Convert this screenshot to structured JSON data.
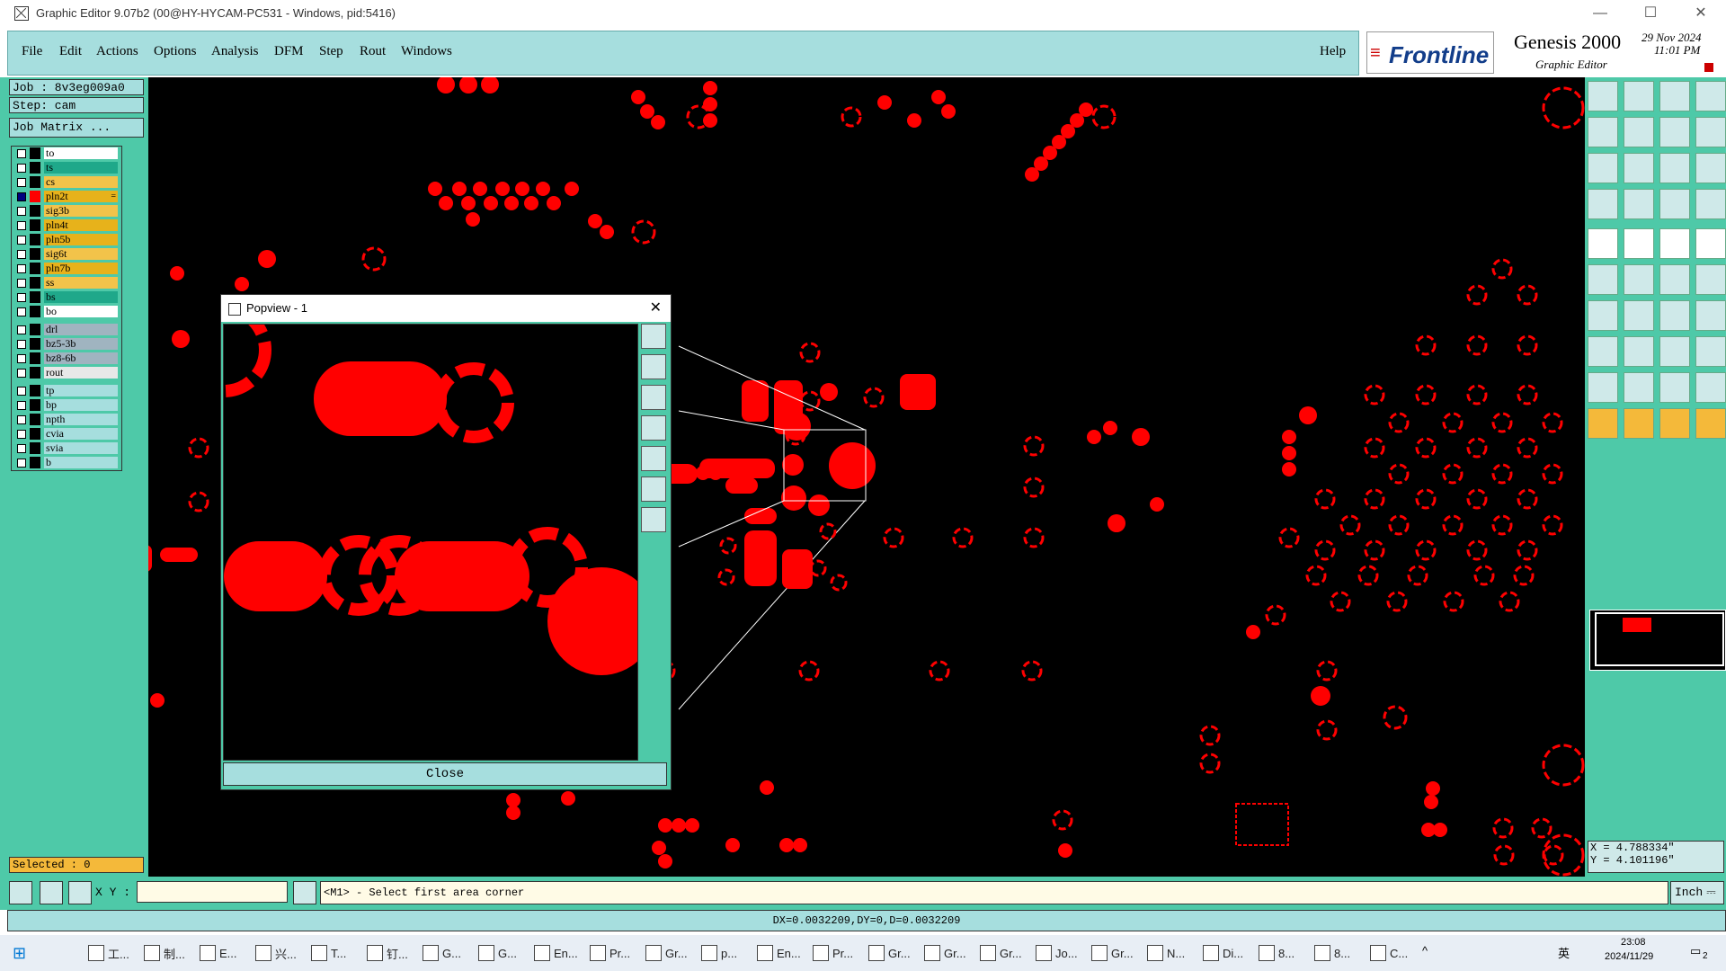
{
  "window": {
    "title": "Graphic Editor 9.07b2 (00@HY-HYCAM-PC531 - Windows, pid:5416)",
    "controls": [
      "minimize-icon",
      "maximize-icon",
      "close-icon"
    ]
  },
  "menu": {
    "items": [
      "File",
      "Edit",
      "Actions",
      "Options",
      "Analysis",
      "DFM",
      "Step",
      "Rout",
      "Windows"
    ],
    "help": "Help"
  },
  "brand": {
    "logo": "Frontline",
    "product": "Genesis 2000",
    "sub": "Graphic Editor",
    "date": "29 Nov 2024",
    "time": "11:01 PM"
  },
  "job": {
    "job_label": "Job : 8v3eg009a0",
    "step_label": "Step: cam",
    "matrix_btn": "Job Matrix ..."
  },
  "layers": [
    {
      "name": "to",
      "color": "#ffffff",
      "checked": false
    },
    {
      "name": "ts",
      "color": "#1fa88a",
      "checked": false
    },
    {
      "name": "cs",
      "color": "#f2c34a",
      "checked": false
    },
    {
      "name": "pln2t",
      "color": "#e7b21b",
      "checked": true,
      "active": true,
      "mark": "="
    },
    {
      "name": "sig3b",
      "color": "#f2c34a",
      "checked": false
    },
    {
      "name": "pln4t",
      "color": "#e7b21b",
      "checked": false
    },
    {
      "name": "pln5b",
      "color": "#e7b21b",
      "checked": false
    },
    {
      "name": "sig6t",
      "color": "#f2c34a",
      "checked": false
    },
    {
      "name": "pln7b",
      "color": "#e7b21b",
      "checked": false
    },
    {
      "name": "ss",
      "color": "#f2c34a",
      "checked": false
    },
    {
      "name": "bs",
      "color": "#1fa88a",
      "checked": false
    },
    {
      "name": "bo",
      "color": "#ffffff",
      "checked": false
    },
    {
      "name": "drl",
      "color": "#a0b4c0",
      "checked": false
    },
    {
      "name": "bz5-3b",
      "color": "#a0b4c0",
      "checked": false
    },
    {
      "name": "bz8-6b",
      "color": "#a0b4c0",
      "checked": false
    },
    {
      "name": "rout",
      "color": "#e8e8e8",
      "checked": false
    },
    {
      "name": "tp",
      "color": "#a6dede",
      "checked": false
    },
    {
      "name": "bp",
      "color": "#a6dede",
      "checked": false
    },
    {
      "name": "npth",
      "color": "#a6dede",
      "checked": false
    },
    {
      "name": "cvia",
      "color": "#a6dede",
      "checked": false
    },
    {
      "name": "svia",
      "color": "#a6dede",
      "checked": false
    },
    {
      "name": "b",
      "color": "#a6dede",
      "checked": false
    }
  ],
  "selected": "Selected : 0",
  "popview": {
    "title": "Popview - 1",
    "close_label": "Close"
  },
  "coords": {
    "x": "X = 4.788334\"",
    "y": "Y = 4.101196\""
  },
  "status": {
    "xy_label": "X Y :",
    "xy_value": "",
    "prompt": "<M1> - Select first area corner",
    "units": "Inch",
    "measure": "DX=0.0032209,DY=0,D=0.0032209"
  },
  "colors": {
    "accent": "#4ec9a8",
    "panel": "#a6dede",
    "feature": "#ff0000",
    "canvas": "#000000"
  },
  "taskbar": {
    "items": [
      "工...",
      "制...",
      "E...",
      "兴...",
      "T...",
      "钉...",
      "G...",
      "G...",
      "En...",
      "Pr...",
      "Gr...",
      "p...",
      "En...",
      "Pr...",
      "Gr...",
      "Gr...",
      "Gr...",
      "Jo...",
      "Gr...",
      "N...",
      "Di...",
      "8...",
      "8...",
      "C..."
    ],
    "time": "23:08",
    "date": "2024/11/29",
    "ime": "英",
    "notify": "2"
  }
}
